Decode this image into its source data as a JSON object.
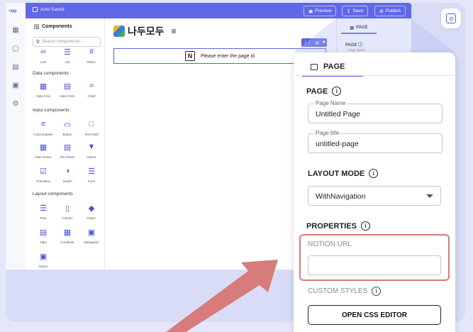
{
  "app": {
    "autosave_text": "Auto Saved",
    "logo": "·∞"
  },
  "toolbar": {
    "preview_label": "Preview",
    "save_label": "Save",
    "publish_label": "Publish"
  },
  "components": {
    "title": "Components",
    "search_placeholder": "Search components...",
    "top_items": [
      "Link",
      "List",
      "Metric"
    ],
    "data_section": "Data components",
    "data_items": [
      "Data Grid",
      "Data Form",
      "Chart"
    ],
    "input_section": "Input components",
    "input_items": [
      "Autocomplete",
      "Button",
      "Text Field",
      "Date Picker",
      "File Picker",
      "Select",
      "Checkbox",
      "Switch",
      "Form"
    ],
    "layout_section": "Layout components",
    "layout_items": [
      "Row",
      "Column",
      "Paper",
      "Tabs",
      "Container",
      "Navigation",
      "Notion"
    ]
  },
  "canvas": {
    "brand_text": "나두모두",
    "notion_logo": "N",
    "notion_placeholder": "Please enter the page id"
  },
  "side_panel": {
    "tab_label": "PAGE",
    "page_heading": "PAGE",
    "page_name_label": "Page Name"
  },
  "zoom_panel": {
    "tab_label": "PAGE",
    "page_heading": "PAGE",
    "page_name_label": "Page Name",
    "page_name_value": "Untitled Page",
    "page_title_label": "Page title",
    "page_title_value": "untitled-page",
    "layout_mode_heading": "LAYOUT MODE",
    "layout_mode_value": "WithNavigation",
    "properties_heading": "PROPERTIES",
    "notion_url_label": "NOTION URL",
    "notion_url_value": "",
    "custom_styles_label": "CUSTOM STYLES",
    "css_button_label": "OPEN CSS EDITOR",
    "info_glyph": "i"
  },
  "colors": {
    "accent": "#6168e8",
    "highlight_border": "#d77a7a",
    "arrow": "#d77b7b",
    "background": "#e4e6fa"
  }
}
